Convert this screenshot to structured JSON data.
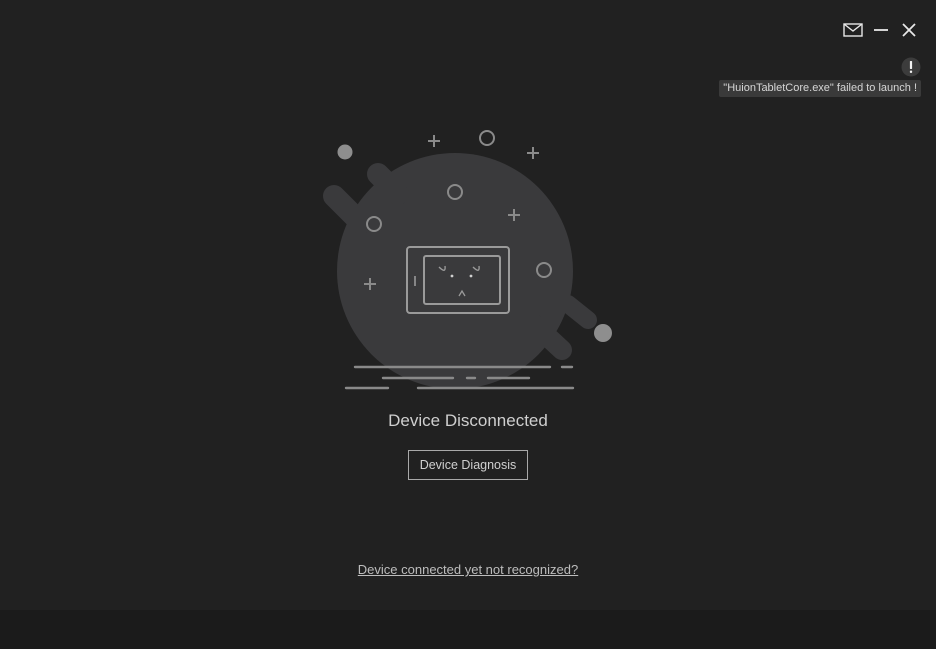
{
  "window": {
    "controls": {
      "mail_icon": "mail-icon",
      "minimize_icon": "minimize-icon",
      "close_icon": "close-icon"
    }
  },
  "notification": {
    "icon": "warning-icon",
    "message": "\"HuionTabletCore.exe\" failed to launch !"
  },
  "main": {
    "illustration_icon": "disconnected-tablet-illustration",
    "status_title": "Device Disconnected",
    "diagnosis_button_label": "Device Diagnosis",
    "help_link_text": "Device connected yet not recognized?"
  },
  "colors": {
    "background": "#212121",
    "footer": "#1b1b1b",
    "blob": "#3a3a3c",
    "line": "#8a8a8a",
    "text": "#cfcfcf"
  }
}
